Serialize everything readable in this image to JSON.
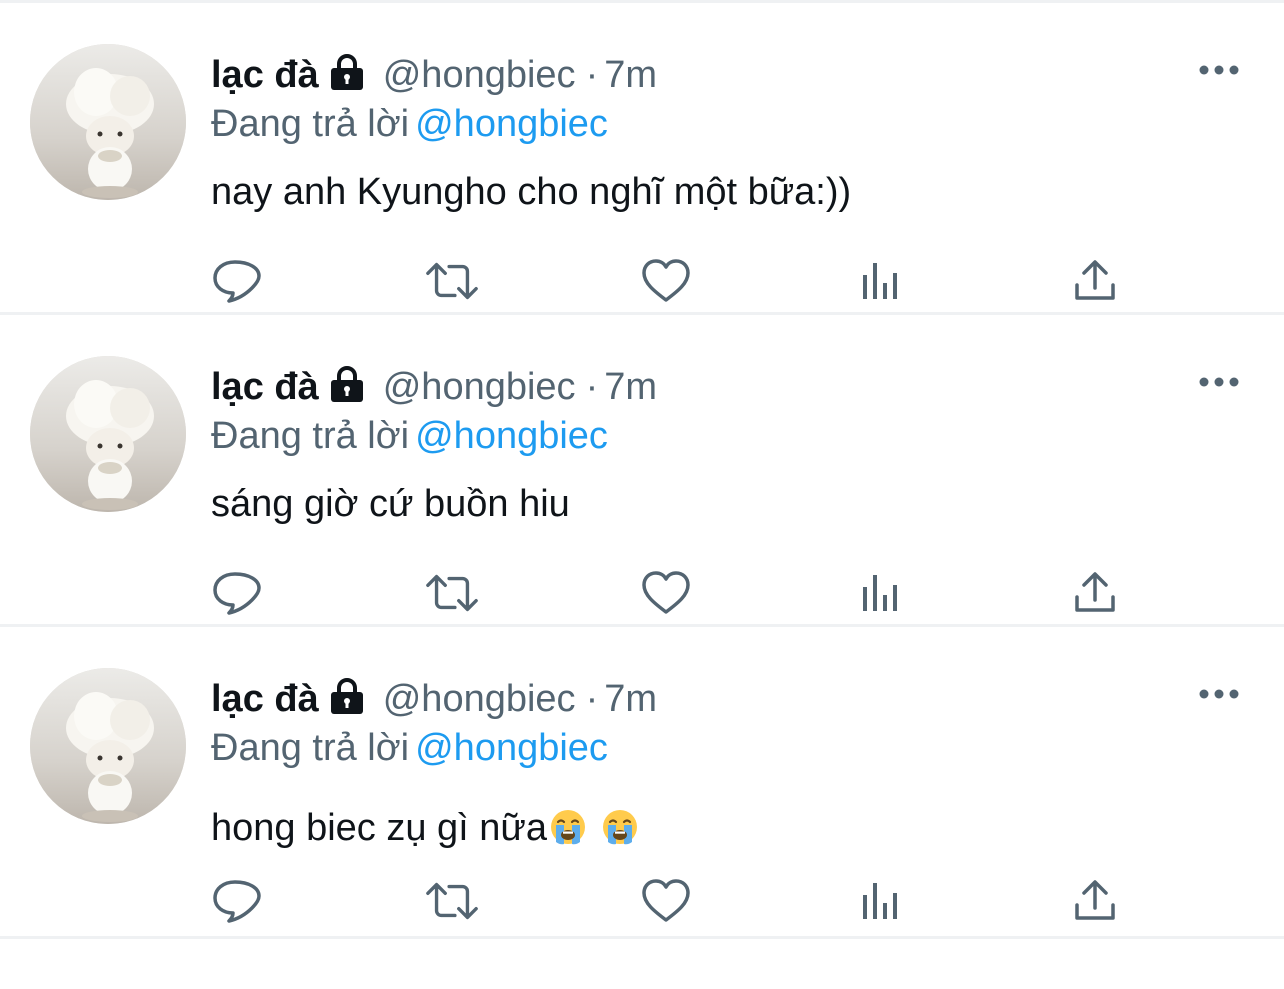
{
  "colors": {
    "text": "#0f1419",
    "secondary": "#536471",
    "accent": "#1d9bf0",
    "divider": "#eff1f3"
  },
  "tweets": [
    {
      "display_name": "lạc đà",
      "handle": "@hongbiec",
      "separator": "·",
      "time": "7m",
      "reply_prefix": "Đang trả lời",
      "reply_to": "@hongbiec",
      "text": "nay anh Kyungho cho nghĩ một bữa:))",
      "emojis": []
    },
    {
      "display_name": "lạc đà",
      "handle": "@hongbiec",
      "separator": "·",
      "time": "7m",
      "reply_prefix": "Đang trả lời",
      "reply_to": "@hongbiec",
      "text": "sáng giờ cứ buồn hiu",
      "emojis": []
    },
    {
      "display_name": "lạc đà",
      "handle": "@hongbiec",
      "separator": "·",
      "time": "7m",
      "reply_prefix": "Đang trả lời",
      "reply_to": "@hongbiec",
      "text": "hong biec zụ gì nữa",
      "emojis": [
        "loudly-crying-face",
        "loudly-crying-face"
      ]
    }
  ],
  "icons": {
    "lock": "lock-icon",
    "more": "more-icon",
    "reply": "reply-icon",
    "retweet": "retweet-icon",
    "like": "heart-icon",
    "stats": "stats-icon",
    "share": "share-icon"
  }
}
